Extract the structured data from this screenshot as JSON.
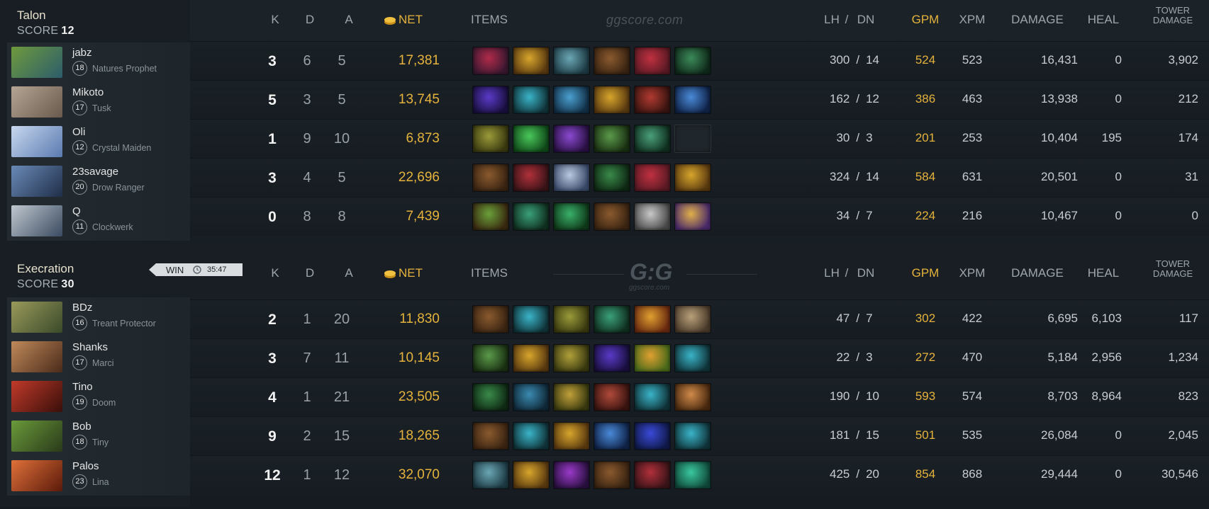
{
  "watermark": "ggscore.com",
  "logo": {
    "text": "G:G",
    "subtext": "ggscore.com"
  },
  "headers": {
    "k": "K",
    "d": "D",
    "a": "A",
    "net": "NET",
    "items": "ITEMS",
    "lh": "LH",
    "slash": "/",
    "dn": "DN",
    "gpm": "GPM",
    "xpm": "XPM",
    "damage": "DAMAGE",
    "heal": "HEAL",
    "tower_line1": "TOWER",
    "tower_line2": "DAMAGE"
  },
  "colors": {
    "gold": "#e5b33c",
    "background": "#141a1f"
  },
  "result": {
    "label": "WIN",
    "duration": "35:47",
    "icon": "clock-icon"
  },
  "teams": [
    {
      "name": "Talon",
      "score_label": "SCORE",
      "score": "12",
      "players": [
        {
          "name": "jabz",
          "level": "18",
          "hero": "Natures Prophet",
          "k": "3",
          "d": "6",
          "a": "5",
          "net": "17,381",
          "lh": "300",
          "dn": "14",
          "gpm": "524",
          "xpm": "523",
          "damage": "16,431",
          "heal": "0",
          "tower": "3,902",
          "avatar_colors": [
            "#6f9a3d",
            "#2c5d6b"
          ],
          "items": [
            [
              "#b02a4a",
              "#3a1830"
            ],
            [
              "#d7a52c",
              "#5a3a10"
            ],
            [
              "#6aa7b4",
              "#1d3a44"
            ],
            [
              "#8a5a2e",
              "#3a2412"
            ],
            [
              "#c03040",
              "#5a1a24"
            ],
            [
              "#3c8a5a",
              "#0f2a1a"
            ]
          ]
        },
        {
          "name": "Mikoto",
          "level": "17",
          "hero": "Tusk",
          "k": "5",
          "d": "3",
          "a": "5",
          "net": "13,745",
          "lh": "162",
          "dn": "12",
          "gpm": "386",
          "xpm": "463",
          "damage": "13,938",
          "heal": "0",
          "tower": "212",
          "avatar_colors": [
            "#b5a594",
            "#6a5a4d"
          ],
          "items": [
            [
              "#5a3ac8",
              "#1a1040"
            ],
            [
              "#3ab4c8",
              "#10343a"
            ],
            [
              "#4aa0d0",
              "#123048"
            ],
            [
              "#d7a52c",
              "#5a3a10"
            ],
            [
              "#b03a30",
              "#3a1410"
            ],
            [
              "#4a8ad8",
              "#10244a"
            ]
          ]
        },
        {
          "name": "Oli",
          "level": "12",
          "hero": "Crystal Maiden",
          "k": "1",
          "d": "9",
          "a": "10",
          "net": "6,873",
          "lh": "30",
          "dn": "3",
          "gpm": "201",
          "xpm": "253",
          "damage": "10,404",
          "heal": "195",
          "tower": "174",
          "avatar_colors": [
            "#c8d8ef",
            "#5a7ab0"
          ],
          "items": [
            [
              "#9a9a3a",
              "#3a3a10"
            ],
            [
              "#4ac85a",
              "#104a1a"
            ],
            [
              "#8a4ad0",
              "#2a1044"
            ],
            [
              "#5a9a4a",
              "#1a3012"
            ],
            [
              "#4aa07a",
              "#103020"
            ],
            null
          ]
        },
        {
          "name": "23savage",
          "level": "20",
          "hero": "Drow Ranger",
          "k": "3",
          "d": "4",
          "a": "5",
          "net": "22,696",
          "lh": "324",
          "dn": "14",
          "gpm": "584",
          "xpm": "631",
          "damage": "20,501",
          "heal": "0",
          "tower": "31",
          "avatar_colors": [
            "#6a8ab8",
            "#1f2e48"
          ],
          "items": [
            [
              "#8a5a2e",
              "#3a2412"
            ],
            [
              "#b0303a",
              "#3a1418"
            ],
            [
              "#b8c8e0",
              "#3a4a6a"
            ],
            [
              "#3a8a4a",
              "#0f2a14"
            ],
            [
              "#c03040",
              "#5a1a24"
            ],
            [
              "#d7a52c",
              "#5a3a10"
            ]
          ]
        },
        {
          "name": "Q",
          "level": "11",
          "hero": "Clockwerk",
          "k": "0",
          "d": "8",
          "a": "8",
          "net": "7,439",
          "lh": "34",
          "dn": "7",
          "gpm": "224",
          "xpm": "216",
          "damage": "10,467",
          "heal": "0",
          "tower": "0",
          "avatar_colors": [
            "#c0c8d0",
            "#3a4a60"
          ],
          "items": [
            [
              "#6aa03a",
              "#3a2a10"
            ],
            [
              "#3aa07a",
              "#103020"
            ],
            [
              "#3ab06a",
              "#0f3a1a"
            ],
            [
              "#8a5a2e",
              "#3a2412"
            ],
            [
              "#c8c8c8",
              "#4a4a4a"
            ],
            [
              "#e0b04a",
              "#4a2a6a"
            ]
          ]
        }
      ]
    },
    {
      "name": "Execration",
      "score_label": "SCORE",
      "score": "30",
      "players": [
        {
          "name": "BDz",
          "level": "16",
          "hero": "Treant Protector",
          "k": "2",
          "d": "1",
          "a": "20",
          "net": "11,830",
          "lh": "47",
          "dn": "7",
          "gpm": "302",
          "xpm": "422",
          "damage": "6,695",
          "heal": "6,103",
          "tower": "117",
          "avatar_colors": [
            "#9a9a5a",
            "#3a4a2a"
          ],
          "items": [
            [
              "#8a5a2e",
              "#3a2412"
            ],
            [
              "#3ab4c8",
              "#10343a"
            ],
            [
              "#9a9a3a",
              "#3a3a10"
            ],
            [
              "#3aa07a",
              "#103020"
            ],
            [
              "#e0a030",
              "#6a2a10"
            ],
            [
              "#b8a07a",
              "#4a3a2a"
            ]
          ]
        },
        {
          "name": "Shanks",
          "level": "17",
          "hero": "Marci",
          "k": "3",
          "d": "7",
          "a": "11",
          "net": "10,145",
          "lh": "22",
          "dn": "3",
          "gpm": "272",
          "xpm": "470",
          "damage": "5,184",
          "heal": "2,956",
          "tower": "1,234",
          "avatar_colors": [
            "#c08a5a",
            "#4a2a1a"
          ],
          "items": [
            [
              "#5a9a4a",
              "#1a3012"
            ],
            [
              "#d7a52c",
              "#5a3a10"
            ],
            [
              "#b0a03a",
              "#3a3a10"
            ],
            [
              "#5a3ac8",
              "#1a1040"
            ],
            [
              "#e0a030",
              "#4a6a1a"
            ],
            [
              "#3ab4c8",
              "#10343a"
            ]
          ]
        },
        {
          "name": "Tino",
          "level": "19",
          "hero": "Doom",
          "k": "4",
          "d": "1",
          "a": "21",
          "net": "23,505",
          "lh": "190",
          "dn": "10",
          "gpm": "593",
          "xpm": "574",
          "damage": "8,703",
          "heal": "8,964",
          "tower": "823",
          "avatar_colors": [
            "#c03a2a",
            "#3a0f0a"
          ],
          "items": [
            [
              "#3a8a4a",
              "#0f2a14"
            ],
            [
              "#3a8ab0",
              "#102a3a"
            ],
            [
              "#c0a03a",
              "#3a3a10"
            ],
            [
              "#b04a3a",
              "#3a1410"
            ],
            [
              "#3ab4c8",
              "#10343a"
            ],
            [
              "#d08a4a",
              "#4a2a10"
            ]
          ]
        },
        {
          "name": "Bob",
          "level": "18",
          "hero": "Tiny",
          "k": "9",
          "d": "2",
          "a": "15",
          "net": "18,265",
          "lh": "181",
          "dn": "15",
          "gpm": "501",
          "xpm": "535",
          "damage": "26,084",
          "heal": "0",
          "tower": "2,045",
          "avatar_colors": [
            "#6a9a3a",
            "#2a3a1a"
          ],
          "items": [
            [
              "#8a5a2e",
              "#3a2412"
            ],
            [
              "#3ab4c8",
              "#10343a"
            ],
            [
              "#d7a52c",
              "#5a3a10"
            ],
            [
              "#4a8ad8",
              "#10244a"
            ],
            [
              "#3a4ad8",
              "#101a4a"
            ],
            [
              "#3ab4c8",
              "#10343a"
            ]
          ]
        },
        {
          "name": "Palos",
          "level": "23",
          "hero": "Lina",
          "k": "12",
          "d": "1",
          "a": "12",
          "net": "32,070",
          "lh": "425",
          "dn": "20",
          "gpm": "854",
          "xpm": "868",
          "damage": "29,444",
          "heal": "0",
          "tower": "30,546",
          "avatar_colors": [
            "#e0703a",
            "#5a1a0a"
          ],
          "items": [
            [
              "#6aa7b4",
              "#1d3a44"
            ],
            [
              "#d7a52c",
              "#5a3a10"
            ],
            [
              "#9a3ac8",
              "#2a1040"
            ],
            [
              "#8a5a2e",
              "#3a2412"
            ],
            [
              "#b0303a",
              "#3a1418"
            ],
            [
              "#3ac8a0",
              "#104a3a"
            ]
          ]
        }
      ]
    }
  ]
}
